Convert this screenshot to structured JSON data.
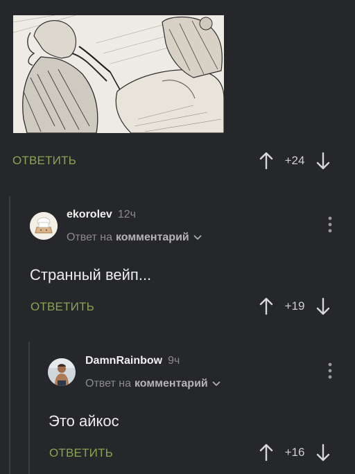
{
  "colors": {
    "background": "#26272a",
    "accent_green": "#8aa552",
    "thread_line": "#3c3d41"
  },
  "top_comment": {
    "reply_label": "ОТВЕТИТЬ",
    "score": "+24"
  },
  "comments": [
    {
      "username": "ekorolev",
      "time": "12ч",
      "reply_prefix": "Ответ на",
      "reply_target": "комментарий",
      "text": "Странный вейп...",
      "reply_label": "ОТВЕТИТЬ",
      "score": "+19",
      "avatar_icon": "chef-avatar-icon"
    },
    {
      "username": "DamnRainbow",
      "time": "9ч",
      "reply_prefix": "Ответ на",
      "reply_target": "комментарий",
      "text": "Это айкос",
      "reply_label": "ОТВЕТИТЬ",
      "score": "+16",
      "avatar_icon": "user-photo-avatar-icon"
    }
  ]
}
